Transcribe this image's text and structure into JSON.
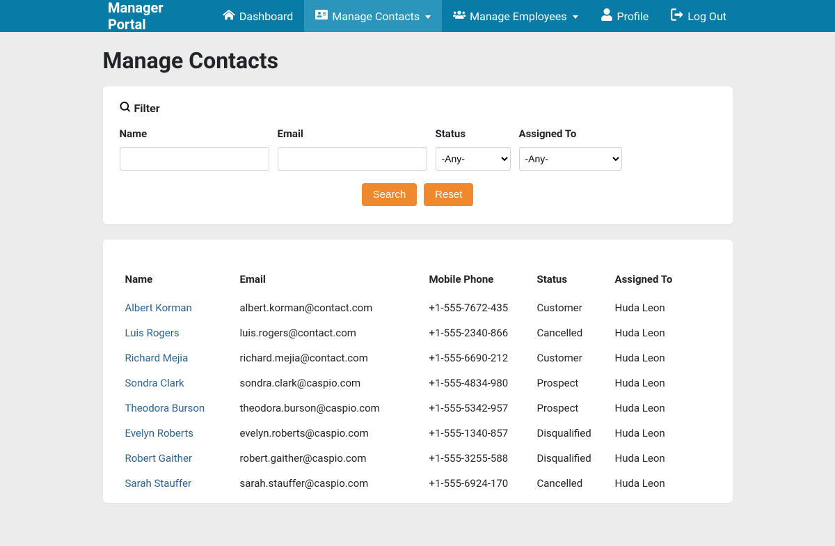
{
  "brand": "Manager Portal",
  "nav": {
    "dashboard": "Dashboard",
    "contacts": "Manage Contacts",
    "employees": "Manage Employees",
    "profile": "Profile",
    "logout": "Log Out"
  },
  "page_title": "Manage Contacts",
  "filter": {
    "header": "Filter",
    "name_label": "Name",
    "email_label": "Email",
    "status_label": "Status",
    "assigned_label": "Assigned To",
    "status_value": "-Any-",
    "assigned_value": "-Any-",
    "search_btn": "Search",
    "reset_btn": "Reset"
  },
  "table": {
    "headers": {
      "name": "Name",
      "email": "Email",
      "phone": "Mobile Phone",
      "status": "Status",
      "assigned": "Assigned To"
    },
    "rows": [
      {
        "name": "Albert Korman",
        "email": "albert.korman@contact.com",
        "phone": "+1-555-7672-435",
        "status": "Customer",
        "assigned": "Huda Leon"
      },
      {
        "name": "Luis Rogers",
        "email": "luis.rogers@contact.com",
        "phone": "+1-555-2340-866",
        "status": "Cancelled",
        "assigned": "Huda Leon"
      },
      {
        "name": "Richard Mejia",
        "email": "richard.mejia@contact.com",
        "phone": "+1-555-6690-212",
        "status": "Customer",
        "assigned": "Huda Leon"
      },
      {
        "name": "Sondra Clark",
        "email": "sondra.clark@caspio.com",
        "phone": "+1-555-4834-980",
        "status": "Prospect",
        "assigned": "Huda Leon"
      },
      {
        "name": "Theodora Burson",
        "email": "theodora.burson@caspio.com",
        "phone": "+1-555-5342-957",
        "status": "Prospect",
        "assigned": "Huda Leon"
      },
      {
        "name": "Evelyn Roberts",
        "email": "evelyn.roberts@caspio.com",
        "phone": "+1-555-1340-857",
        "status": "Disqualified",
        "assigned": "Huda Leon"
      },
      {
        "name": "Robert Gaither",
        "email": "robert.gaither@caspio.com",
        "phone": "+1-555-3255-588",
        "status": "Disqualified",
        "assigned": "Huda Leon"
      },
      {
        "name": "Sarah Stauffer",
        "email": "sarah.stauffer@caspio.com",
        "phone": "+1-555-6924-170",
        "status": "Cancelled",
        "assigned": "Huda Leon"
      }
    ]
  }
}
